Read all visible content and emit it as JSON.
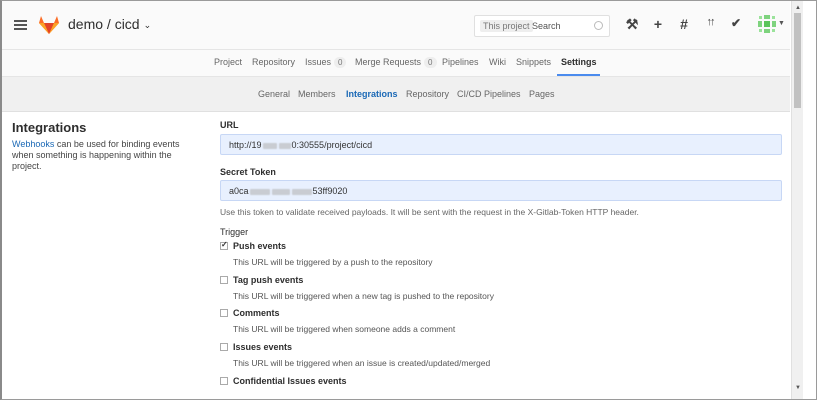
{
  "header": {
    "project_title": "demo / cicd",
    "title_caret": "⌄",
    "search": {
      "scope": "This project",
      "placeholder": "Search"
    },
    "icons": [
      "wrench-icon",
      "plus-icon",
      "hash-icon",
      "merge-request-icon",
      "check-circle-icon"
    ],
    "icon_glyphs": {
      "wrench": "⚒",
      "plus": "+",
      "hash": "#",
      "mr": "↑↑",
      "check": "✔"
    }
  },
  "nav": {
    "items": [
      {
        "label": "Project"
      },
      {
        "label": "Repository"
      },
      {
        "label": "Issues",
        "badge": "0"
      },
      {
        "label": "Merge Requests",
        "badge": "0"
      },
      {
        "label": "Pipelines"
      },
      {
        "label": "Wiki"
      },
      {
        "label": "Snippets"
      },
      {
        "label": "Settings"
      }
    ],
    "active": "Settings"
  },
  "subnav": {
    "items": [
      {
        "label": "General"
      },
      {
        "label": "Members"
      },
      {
        "label": "Integrations"
      },
      {
        "label": "Repository"
      },
      {
        "label": "CI/CD Pipelines"
      },
      {
        "label": "Pages"
      }
    ],
    "active": "Integrations"
  },
  "left": {
    "title": "Integrations",
    "link": "Webhooks",
    "description": " can be used for binding events when something is happening within the project."
  },
  "form": {
    "url_label": "URL",
    "url_prefix": "http://19",
    "url_suffix": "0:30555/project/cicd",
    "token_label": "Secret Token",
    "token_prefix": "a0ca",
    "token_suffix": "53ff9020",
    "token_help": "Use this token to validate received payloads. It will be sent with the request in the X-Gitlab-Token HTTP header.",
    "trigger_label": "Trigger",
    "events": [
      {
        "title": "Push events",
        "desc": "This URL will be triggered by a push to the repository",
        "checked": true
      },
      {
        "title": "Tag push events",
        "desc": "This URL will be triggered when a new tag is pushed to the repository",
        "checked": false
      },
      {
        "title": "Comments",
        "desc": "This URL will be triggered when someone adds a comment",
        "checked": false
      },
      {
        "title": "Issues events",
        "desc": "This URL will be triggered when an issue is created/updated/merged",
        "checked": false
      },
      {
        "title": "Confidential Issues events",
        "desc": "",
        "checked": false
      }
    ]
  },
  "colors": {
    "accent": "#1b69b6",
    "tab_underline": "#4a8bee",
    "logo": "#e24329",
    "input_bg": "#e8f0fe"
  }
}
